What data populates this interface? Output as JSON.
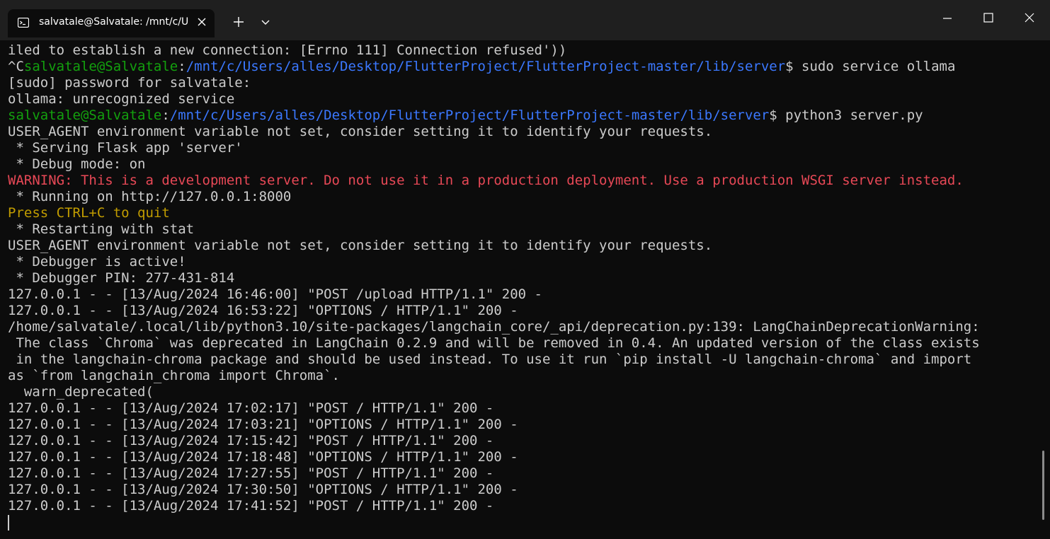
{
  "tab": {
    "title": "salvatale@Salvatale: /mnt/c/U",
    "icon": "terminal-icon"
  },
  "colors": {
    "background": "#0c0c0c",
    "foreground": "#cccccc",
    "green": "#13a10e",
    "blue": "#3b78ff",
    "red": "#e74856",
    "yellow": "#c19c00"
  },
  "terminal": {
    "lines": [
      [
        {
          "t": "iled to establish a new connection: [Errno 111] Connection refused'))",
          "c": ""
        }
      ],
      [
        {
          "t": "^C",
          "c": ""
        },
        {
          "t": "salvatale@Salvatale",
          "c": "green"
        },
        {
          "t": ":",
          "c": ""
        },
        {
          "t": "/mnt/c/Users/alles/Desktop/FlutterProject/FlutterProject-master/lib/server",
          "c": "blue"
        },
        {
          "t": "$ sudo service ollama",
          "c": ""
        }
      ],
      [
        {
          "t": "[sudo] password for salvatale:",
          "c": ""
        }
      ],
      [
        {
          "t": "ollama: unrecognized service",
          "c": ""
        }
      ],
      [
        {
          "t": "salvatale@Salvatale",
          "c": "green"
        },
        {
          "t": ":",
          "c": ""
        },
        {
          "t": "/mnt/c/Users/alles/Desktop/FlutterProject/FlutterProject-master/lib/server",
          "c": "blue"
        },
        {
          "t": "$ python3 server.py",
          "c": ""
        }
      ],
      [
        {
          "t": "USER_AGENT environment variable not set, consider setting it to identify your requests.",
          "c": ""
        }
      ],
      [
        {
          "t": " * Serving Flask app 'server'",
          "c": ""
        }
      ],
      [
        {
          "t": " * Debug mode: on",
          "c": ""
        }
      ],
      [
        {
          "t": "WARNING: This is a development server. Do not use it in a production deployment. Use a production WSGI server instead.",
          "c": "red"
        }
      ],
      [
        {
          "t": " * Running on http://127.0.0.1:8000",
          "c": ""
        }
      ],
      [
        {
          "t": "Press CTRL+C to quit",
          "c": "yellow"
        }
      ],
      [
        {
          "t": " * Restarting with stat",
          "c": ""
        }
      ],
      [
        {
          "t": "USER_AGENT environment variable not set, consider setting it to identify your requests.",
          "c": ""
        }
      ],
      [
        {
          "t": " * Debugger is active!",
          "c": ""
        }
      ],
      [
        {
          "t": " * Debugger PIN: 277-431-814",
          "c": ""
        }
      ],
      [
        {
          "t": "127.0.0.1 - - [13/Aug/2024 16:46:00] \"POST /upload HTTP/1.1\" 200 -",
          "c": ""
        }
      ],
      [
        {
          "t": "127.0.0.1 - - [13/Aug/2024 16:53:22] \"OPTIONS / HTTP/1.1\" 200 -",
          "c": ""
        }
      ],
      [
        {
          "t": "/home/salvatale/.local/lib/python3.10/site-packages/langchain_core/_api/deprecation.py:139: LangChainDeprecationWarning:",
          "c": ""
        }
      ],
      [
        {
          "t": " The class `Chroma` was deprecated in LangChain 0.2.9 and will be removed in 0.4. An updated version of the class exists",
          "c": ""
        }
      ],
      [
        {
          "t": " in the langchain-chroma package and should be used instead. To use it run `pip install -U langchain-chroma` and import",
          "c": ""
        }
      ],
      [
        {
          "t": "as `from langchain_chroma import Chroma`.",
          "c": ""
        }
      ],
      [
        {
          "t": "  warn_deprecated(",
          "c": ""
        }
      ],
      [
        {
          "t": "127.0.0.1 - - [13/Aug/2024 17:02:17] \"POST / HTTP/1.1\" 200 -",
          "c": ""
        }
      ],
      [
        {
          "t": "127.0.0.1 - - [13/Aug/2024 17:03:21] \"OPTIONS / HTTP/1.1\" 200 -",
          "c": ""
        }
      ],
      [
        {
          "t": "127.0.0.1 - - [13/Aug/2024 17:15:42] \"POST / HTTP/1.1\" 200 -",
          "c": ""
        }
      ],
      [
        {
          "t": "127.0.0.1 - - [13/Aug/2024 17:18:48] \"OPTIONS / HTTP/1.1\" 200 -",
          "c": ""
        }
      ],
      [
        {
          "t": "127.0.0.1 - - [13/Aug/2024 17:27:55] \"POST / HTTP/1.1\" 200 -",
          "c": ""
        }
      ],
      [
        {
          "t": "127.0.0.1 - - [13/Aug/2024 17:30:50] \"OPTIONS / HTTP/1.1\" 200 -",
          "c": ""
        }
      ],
      [
        {
          "t": "127.0.0.1 - - [13/Aug/2024 17:41:52] \"POST / HTTP/1.1\" 200 -",
          "c": ""
        }
      ]
    ]
  }
}
